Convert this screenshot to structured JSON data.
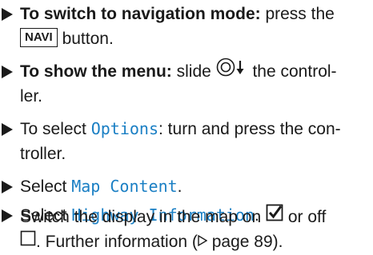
{
  "steps": [
    {
      "bold": "To switch to navigation mode:",
      "text_a": " press the",
      "button_label": "NAVI",
      "text_b": " button."
    },
    {
      "bold": "To show the menu:",
      "text_a": " slide ",
      "control_icon": "controller-slide-down-icon",
      "text_b": " the control-",
      "text_c": "ler."
    },
    {
      "text_a": "To select ",
      "menu": "Options",
      "text_b": ": turn and press the con-",
      "text_c": "troller."
    },
    {
      "text_a": "Select ",
      "menu": "Map Content",
      "text_b": "."
    },
    {
      "text_a": "Select ",
      "menu": "Highway Information",
      "text_b": ".",
      "line2_a": "Switch the display in the map on ",
      "checked_icon": "checkbox-checked-icon",
      "line2_b": " or off",
      "unchecked_icon": "checkbox-unchecked-icon",
      "line3_b": ". Further information (",
      "page_ref_icon": "page-reference-triangle-icon",
      "page_ref": " page 89",
      "line3_c": ")."
    }
  ],
  "colors": {
    "text": "#1a1a1a",
    "menu_text": "#1a7fc4"
  }
}
